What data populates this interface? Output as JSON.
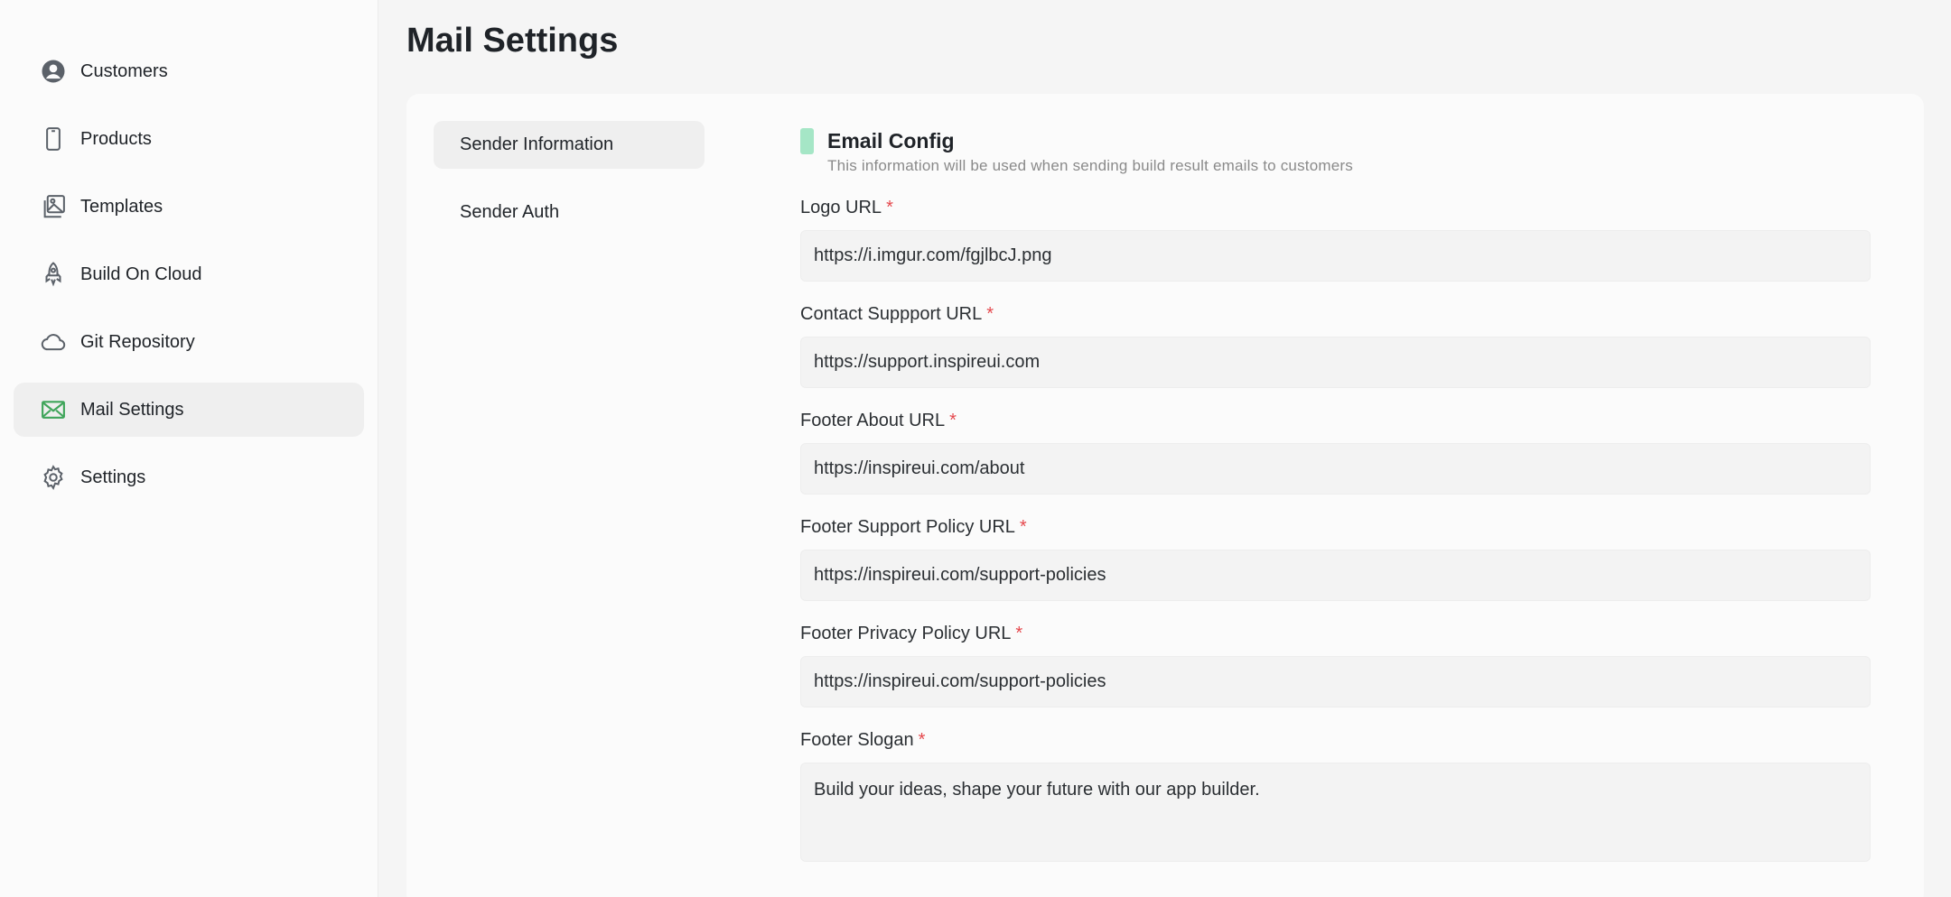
{
  "sidebar": {
    "items": [
      {
        "label": "Customers",
        "icon": "user-circle-icon",
        "active": false
      },
      {
        "label": "Products",
        "icon": "phone-icon",
        "active": false
      },
      {
        "label": "Templates",
        "icon": "images-icon",
        "active": false
      },
      {
        "label": "Build On Cloud",
        "icon": "rocket-icon",
        "active": false
      },
      {
        "label": "Git Repository",
        "icon": "cloud-icon",
        "active": false
      },
      {
        "label": "Mail Settings",
        "icon": "mail-icon",
        "active": true
      },
      {
        "label": "Settings",
        "icon": "gear-icon",
        "active": false
      }
    ]
  },
  "page": {
    "title": "Mail Settings"
  },
  "subnav": {
    "items": [
      {
        "label": "Sender Information",
        "active": true
      },
      {
        "label": "Sender Auth",
        "active": false
      }
    ]
  },
  "section": {
    "title": "Email Config",
    "description": "This information will be used when sending build result emails to customers"
  },
  "fields": [
    {
      "label": "Logo URL",
      "required": "*",
      "value": "https://i.imgur.com/fgjlbcJ.png"
    },
    {
      "label": "Contact Suppport URL",
      "required": "*",
      "value": "https://support.inspireui.com"
    },
    {
      "label": "Footer About URL",
      "required": "*",
      "value": "https://inspireui.com/about"
    },
    {
      "label": "Footer Support Policy URL",
      "required": "*",
      "value": "https://inspireui.com/support-policies"
    },
    {
      "label": "Footer Privacy Policy URL",
      "required": "*",
      "value": "https://inspireui.com/support-policies"
    },
    {
      "label": "Footer Slogan",
      "required": "*",
      "value": "Build your ideas, shape your future with our app builder."
    }
  ],
  "colors": {
    "accent": "#a5e6c6",
    "active_icon": "#3fa55a",
    "required": "#e5484d"
  }
}
